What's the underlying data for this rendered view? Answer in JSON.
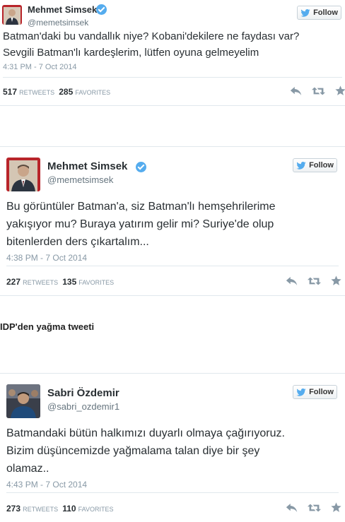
{
  "tweets": [
    {
      "name": "Mehmet Simsek",
      "handle": "@memetsimsek",
      "follow_label": "Follow",
      "text": "Batman'daki bu vandallık niye? Kobani'dekilere ne faydası var?\nSevgili Batman'lı kardeşlerim, lütfen oyuna gelmeyelim",
      "timestamp": "4:31 PM - 7 Oct 2014",
      "retweets": "517",
      "retweets_label": "RETWEETS",
      "favorites": "285",
      "favorites_label": "FAVORITES"
    },
    {
      "name": "Mehmet Simsek",
      "handle": "@memetsimsek",
      "follow_label": "Follow",
      "text": "Bu görüntüler Batman'a, siz Batman'lı hemşehrilerime\nyakışıyor mu? Buraya yatırım gelir mi? Suriye'de olup\nbitenlerden ders çıkartalım...",
      "timestamp": "4:38 PM - 7 Oct 2014",
      "retweets": "227",
      "retweets_label": "RETWEETS",
      "favorites": "135",
      "favorites_label": "FAVORITES"
    },
    {
      "name": "Sabri Özdemir",
      "handle": "@sabri_ozdemir1",
      "follow_label": "Follow",
      "text": "Batmandaki bütün halkımızı duyarlı olmaya çağırıyoruz.\nBizim düşüncemizde yağmalama talan diye bir şey\nolamaz..",
      "timestamp": "4:43 PM - 7 Oct 2014",
      "retweets": "273",
      "retweets_label": "RETWEETS",
      "favorites": "110",
      "favorites_label": "FAVORITES"
    }
  ],
  "section_title": "IDP'den yağma tweeti",
  "colors": {
    "twitter_blue": "#55acee",
    "muted": "#8899a6",
    "text": "#292f33"
  }
}
